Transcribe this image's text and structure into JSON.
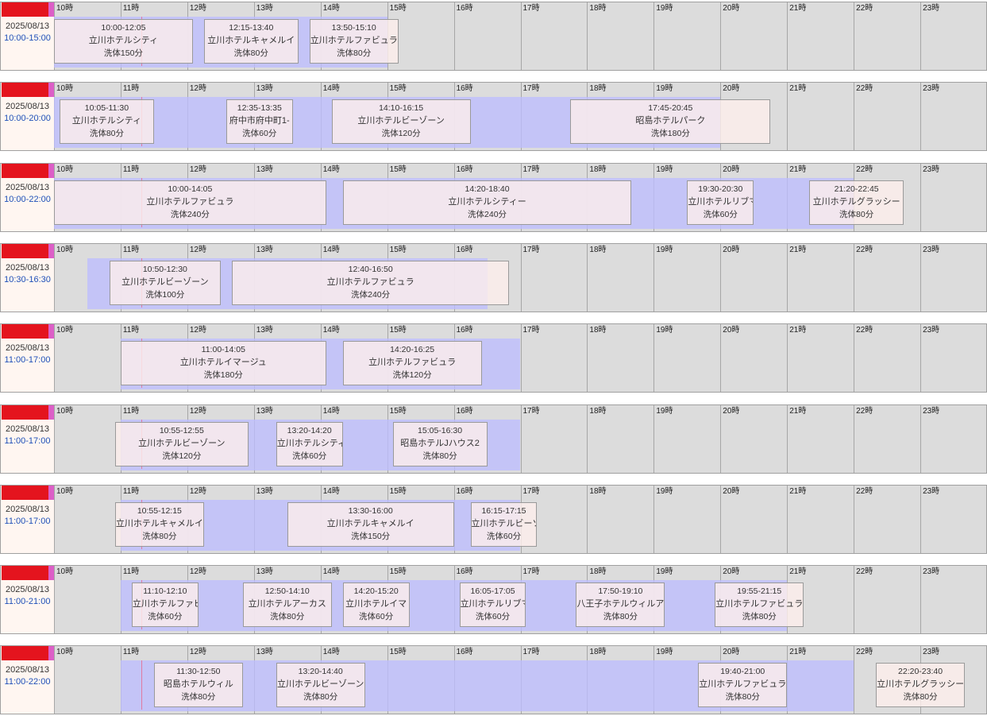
{
  "colors": {
    "grid_bg": "#dcdcdc",
    "grid_line": "#a6a6a6",
    "shift_band": "rgba(190,190,255,0.78)",
    "booking_bg": "rgba(252,238,236,0.82)",
    "booking_border": "#9a9a9a",
    "staff_cell_bg": "#fff6f1",
    "shift_text": "#1f50b8",
    "name_redaction": "#e4141e",
    "name_redaction_accent": "#dc5fc8",
    "now_marker": "#e07aa0"
  },
  "timeline": {
    "hours": [
      "10時",
      "11時",
      "12時",
      "13時",
      "14時",
      "15時",
      "16時",
      "17時",
      "18時",
      "19時",
      "20時",
      "21時",
      "22時",
      "23時"
    ],
    "now_marker_hours": 11.31
  },
  "staff": [
    {
      "date": "2025/08/13",
      "shift": "10:00-15:00",
      "bookings": [
        {
          "time": "10:00-12:05",
          "place": "立川ホテルシティ",
          "service": "洗体150分"
        },
        {
          "time": "12:15-13:40",
          "place": "立川ホテルキャメルイ",
          "service": "洗体80分"
        },
        {
          "time": "13:50-15:10",
          "place": "立川ホテルファビュラ",
          "service": "洗体80分"
        }
      ]
    },
    {
      "date": "2025/08/13",
      "shift": "10:00-20:00",
      "bookings": [
        {
          "time": "10:05-11:30",
          "place": "立川ホテルシティ",
          "service": "洗体80分"
        },
        {
          "time": "12:35-13:35",
          "place": "府中市府中町1-",
          "service": "洗体60分"
        },
        {
          "time": "14:10-16:15",
          "place": "立川ホテルビーゾーン",
          "service": "洗体120分"
        },
        {
          "time": "17:45-20:45",
          "place": "昭島ホテルパーク",
          "service": "洗体180分"
        }
      ]
    },
    {
      "date": "2025/08/13",
      "shift": "10:00-22:00",
      "bookings": [
        {
          "time": "10:00-14:05",
          "place": "立川ホテルファビュラ",
          "service": "洗体240分"
        },
        {
          "time": "14:20-18:40",
          "place": "立川ホテルシティー",
          "service": "洗体240分"
        },
        {
          "time": "19:30-20:30",
          "place": "立川ホテルリブマ",
          "service": "洗体60分"
        },
        {
          "time": "21:20-22:45",
          "place": "立川ホテルグラッシー",
          "service": "洗体80分"
        }
      ]
    },
    {
      "date": "2025/08/13",
      "shift": "10:30-16:30",
      "bookings": [
        {
          "time": "10:50-12:30",
          "place": "立川ホテルビーゾーン",
          "service": "洗体100分"
        },
        {
          "time": "12:40-16:50",
          "place": "立川ホテルファビュラ",
          "service": "洗体240分"
        }
      ]
    },
    {
      "date": "2025/08/13",
      "shift": "11:00-17:00",
      "bookings": [
        {
          "time": "11:00-14:05",
          "place": "立川ホテルイマージュ",
          "service": "洗体180分"
        },
        {
          "time": "14:20-16:25",
          "place": "立川ホテルファビュラ",
          "service": "洗体120分"
        }
      ]
    },
    {
      "date": "2025/08/13",
      "shift": "11:00-17:00",
      "bookings": [
        {
          "time": "10:55-12:55",
          "place": "立川ホテルビーゾーン",
          "service": "洗体120分"
        },
        {
          "time": "13:20-14:20",
          "place": "立川ホテルシティ",
          "service": "洗体60分"
        },
        {
          "time": "15:05-16:30",
          "place": "昭島ホテルJハウス2",
          "service": "洗体80分"
        }
      ]
    },
    {
      "date": "2025/08/13",
      "shift": "11:00-17:00",
      "bookings": [
        {
          "time": "10:55-12:15",
          "place": "立川ホテルキャメルイ",
          "service": "洗体80分"
        },
        {
          "time": "13:30-16:00",
          "place": "立川ホテルキャメルイ",
          "service": "洗体150分"
        },
        {
          "time": "16:15-17:15",
          "place": "立川ホテルビーゾ",
          "service": "洗体60分"
        }
      ]
    },
    {
      "date": "2025/08/13",
      "shift": "11:00-21:00",
      "bookings": [
        {
          "time": "11:10-12:10",
          "place": "立川ホテルファビ",
          "service": "洗体60分"
        },
        {
          "time": "12:50-14:10",
          "place": "立川ホテルアーカス",
          "service": "洗体80分"
        },
        {
          "time": "14:20-15:20",
          "place": "立川ホテルイマ",
          "service": "洗体60分"
        },
        {
          "time": "16:05-17:05",
          "place": "立川ホテルリブマ",
          "service": "洗体60分"
        },
        {
          "time": "17:50-19:10",
          "place": "八王子ホテルウィルア",
          "service": "洗体80分"
        },
        {
          "time": "19:55-21:15",
          "place": "立川ホテルファビュラ",
          "service": "洗体80分"
        }
      ]
    },
    {
      "date": "2025/08/13",
      "shift": "11:00-22:00",
      "bookings": [
        {
          "time": "11:30-12:50",
          "place": "昭島ホテルウィル",
          "service": "洗体80分"
        },
        {
          "time": "13:20-14:40",
          "place": "立川ホテルビーゾーン",
          "service": "洗体80分"
        },
        {
          "time": "19:40-21:00",
          "place": "立川ホテルファビュラ",
          "service": "洗体80分"
        },
        {
          "time": "22:20-23:40",
          "place": "立川ホテルグラッシー",
          "service": "洗体80分"
        }
      ]
    }
  ]
}
